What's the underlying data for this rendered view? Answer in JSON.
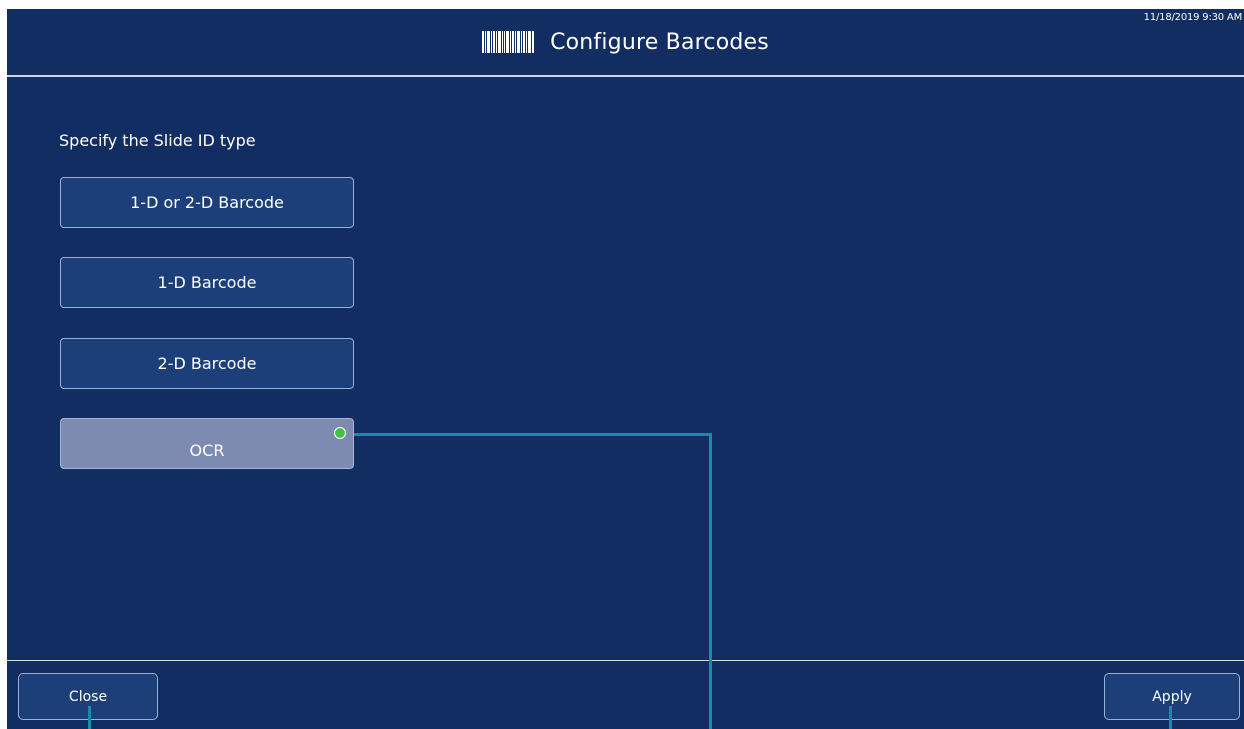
{
  "header": {
    "timestamp": "11/18/2019 9:30 AM",
    "title": "Configure Barcodes",
    "title_icon": "barcode-icon"
  },
  "main": {
    "prompt": "Specify the Slide ID type",
    "options": [
      {
        "label": "1-D or 2-D Barcode",
        "selected": false
      },
      {
        "label": "1-D Barcode",
        "selected": false
      },
      {
        "label": "2-D Barcode",
        "selected": false
      },
      {
        "label": "OCR",
        "selected": true
      }
    ]
  },
  "footer": {
    "close_label": "Close",
    "apply_label": "Apply"
  },
  "colors": {
    "background": "#112d61",
    "button": "#1c3f7a",
    "selected_button": "#7d8bb0",
    "selection_dot": "#47c04a",
    "callout_line": "#1a8aa8"
  }
}
